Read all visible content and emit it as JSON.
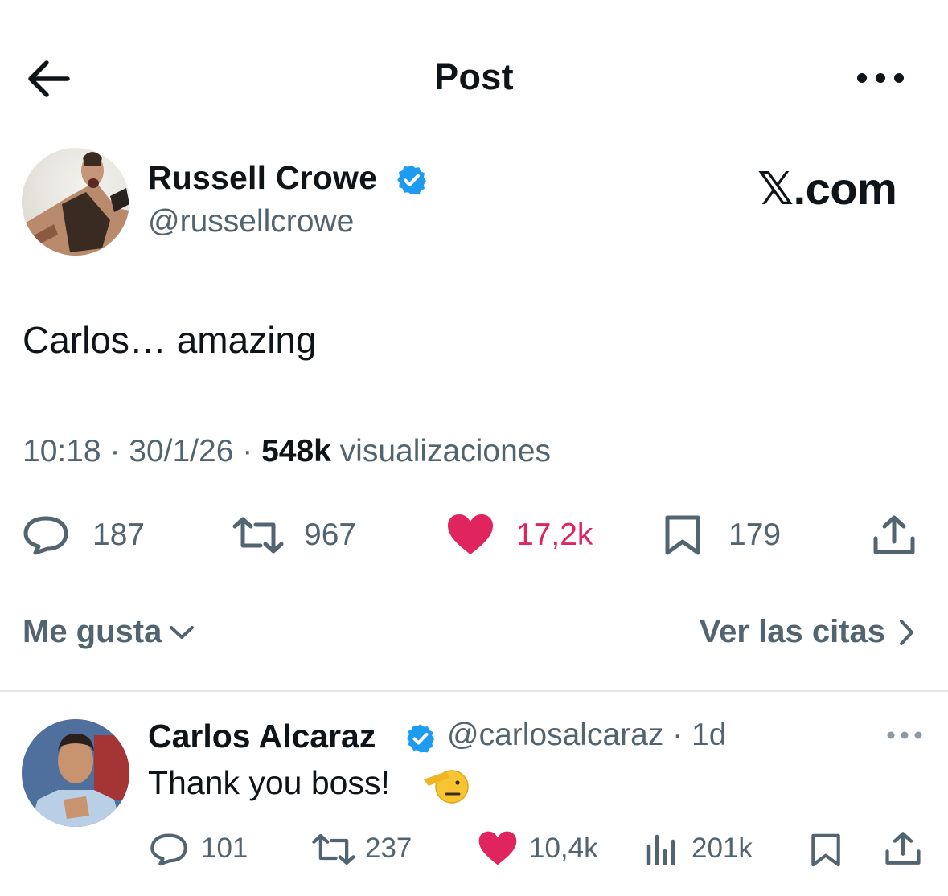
{
  "header": {
    "title": "Post"
  },
  "post": {
    "author": {
      "name": "Russell Crowe",
      "handle": "@russellcrowe"
    },
    "watermark": "𝕏.com",
    "text": "Carlos… amazing",
    "meta": {
      "time": "10:18",
      "sep1": " · ",
      "date": "30/1/26",
      "sep2": " · ",
      "views": "548k",
      "views_label": " visualizaciones"
    },
    "stats": {
      "replies": "187",
      "reposts": "967",
      "likes": "17,2k",
      "bookmarks": "179"
    },
    "likes_sort_label": "Me gusta",
    "quotes_label": "Ver las citas"
  },
  "reply": {
    "author": {
      "name": "Carlos Alcaraz",
      "handle": "@carlosalcaraz",
      "sep": " · ",
      "age": "1d"
    },
    "text": "Thank you boss!",
    "stats": {
      "replies": "101",
      "reposts": "237",
      "likes": "10,4k",
      "views": "201k"
    }
  },
  "colors": {
    "like_pink": "#e0245e",
    "verified_blue": "#1d9bf0",
    "muted": "#536471",
    "text": "#0f1419"
  }
}
